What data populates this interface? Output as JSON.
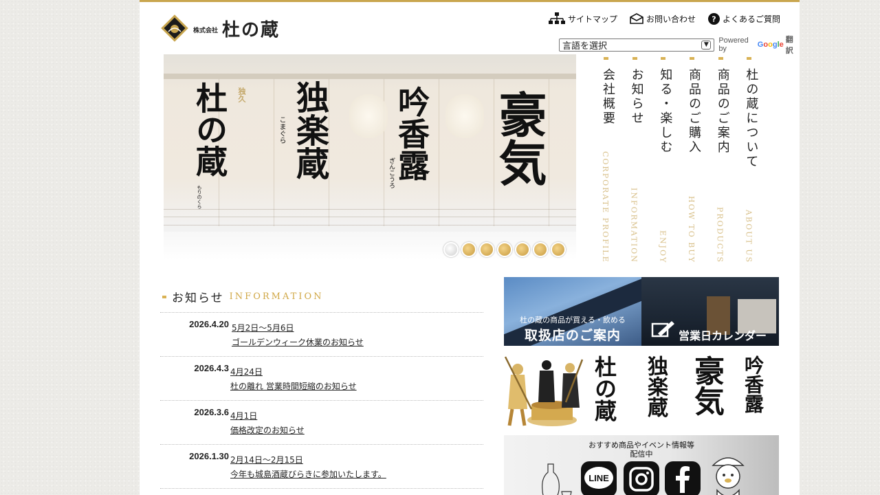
{
  "brand": {
    "corp_prefix": "株式会社",
    "name": "杜の蔵",
    "accent_color": "#c9a64f"
  },
  "header": {
    "links": [
      {
        "label": "サイトマップ",
        "icon": "sitemap-icon"
      },
      {
        "label": "お問い合わせ",
        "icon": "mail-icon"
      },
      {
        "label": "よくあるご質問",
        "icon": "question-icon"
      }
    ],
    "language_select": {
      "value": "言語を選択"
    },
    "powered_by": "Powered by",
    "google": [
      "G",
      "o",
      "o",
      "g",
      "l",
      "e"
    ],
    "translate": "翻訳"
  },
  "hero": {
    "banners": [
      {
        "text": "杜の蔵",
        "ruby": "もりのくら",
        "small": "独久"
      },
      {
        "text": "独楽蔵",
        "ruby": "こまぐら"
      },
      {
        "text": "吟香露",
        "ruby": "ぎんこうろ"
      },
      {
        "text": "豪気"
      }
    ],
    "slide_count": 7,
    "active_slide": 0
  },
  "nav": {
    "items": [
      {
        "ja": "会社概要",
        "en": "CORPORATE PROFILE"
      },
      {
        "ja": "お知らせ",
        "en": "INFORMATION"
      },
      {
        "ja": "知る・楽しむ",
        "en": "ENJOY"
      },
      {
        "ja": "商品のご購入",
        "en": "HOW TO BUY"
      },
      {
        "ja": "商品のご案内",
        "en": "PRODUCTS"
      },
      {
        "ja": "杜の蔵について",
        "en": "ABOUT US"
      }
    ]
  },
  "news": {
    "title_ja": "お知らせ",
    "title_en": "INFORMATION",
    "items": [
      {
        "date": "2026.4.20",
        "line1": "5月2日〜5月6日",
        "line2": "ゴールデンウィーク休業のお知らせ"
      },
      {
        "date": "2026.4.3",
        "line1": "4月24日",
        "line2": "杜の離れ 営業時間短縮のお知らせ"
      },
      {
        "date": "2026.3.6",
        "line1": "4月1日",
        "line2": "価格改定のお知らせ"
      },
      {
        "date": "2026.1.30",
        "line1": "2月14日〜2月15日",
        "line2": "今年も城島酒蔵びらきに参加いたします。"
      }
    ]
  },
  "side_banners": {
    "shops_small": "杜の蔵の商品が買える・飲める",
    "shops_big": "取扱店のご案内",
    "calendar": "営業日カレンダー",
    "brands": [
      "杜の蔵",
      "独楽蔵",
      "豪気",
      "吟香露"
    ],
    "sns_caption_1": "おすすめ商品やイベント情報等",
    "sns_caption_2": "配信中",
    "sns": [
      "LINE",
      "instagram-icon",
      "facebook-icon"
    ]
  }
}
